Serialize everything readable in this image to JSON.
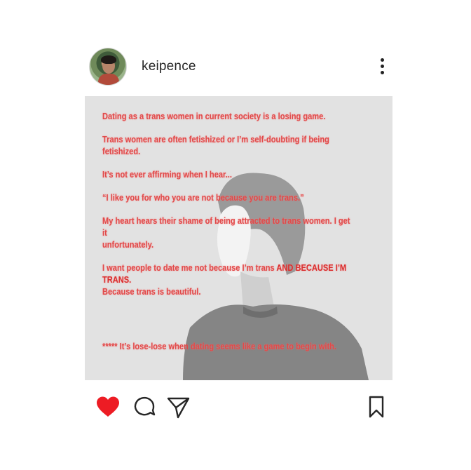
{
  "post": {
    "username": "keipence",
    "caption": {
      "line1": "Dating as a trans women in current society is a losing game.",
      "line2": "Trans women are often fetishized or I’m self-doubting if being fetishized.",
      "line3": "It’s not ever affirming when I hear...",
      "line4": "“I like you for who you are not because you are trans.”",
      "line5": "My heart hears their shame of being attracted to trans women. I get it\nunfortunately.",
      "line6a": "I want people to date me not because I’m trans ",
      "line6b": "AND BECAUSE I’M TRANS.",
      "line6c": "Because trans is beautiful.",
      "footer": "***** It’s lose-lose when dating seems like a game to begin with."
    }
  },
  "actions": {
    "liked": true,
    "like_color": "#ed1c24",
    "icons": [
      "heart-icon",
      "comment-icon",
      "share-icon",
      "bookmark-icon"
    ]
  },
  "header": {
    "more_icon": "more-vertical-icon"
  }
}
